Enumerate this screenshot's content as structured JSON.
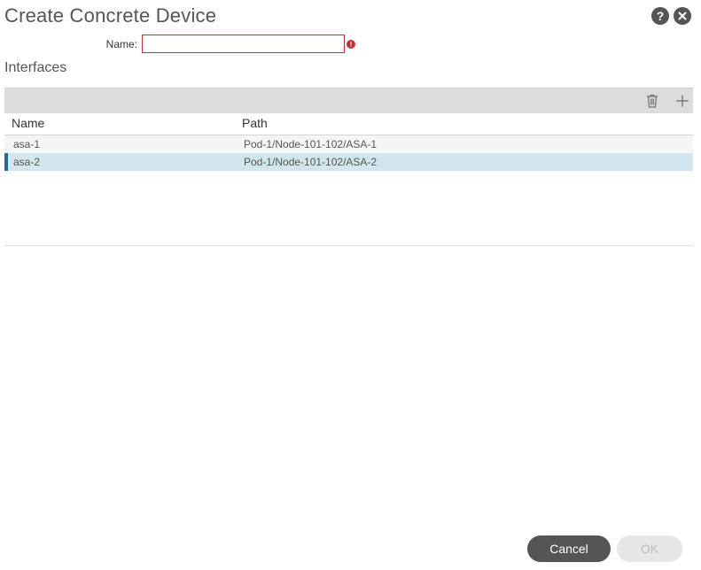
{
  "dialog": {
    "title": "Create Concrete Device",
    "help_icon": "question-icon",
    "close_icon": "close-icon"
  },
  "form": {
    "name_label": "Name:",
    "name_value": "",
    "name_placeholder": "",
    "error_icon": "error-icon"
  },
  "interfaces": {
    "section_label": "Interfaces",
    "toolbar": {
      "delete_icon": "trash-icon",
      "add_icon": "plus-icon"
    },
    "columns": [
      "Name",
      "Path"
    ],
    "rows": [
      {
        "name": "asa-1",
        "path": "Pod-1/Node-101-102/ASA-1",
        "selected": false
      },
      {
        "name": "asa-2",
        "path": "Pod-1/Node-101-102/ASA-2",
        "selected": true
      }
    ]
  },
  "footer": {
    "cancel_label": "Cancel",
    "ok_label": "OK"
  },
  "colors": {
    "error": "#c0303c",
    "selected_row": "#d2e6ef",
    "selected_accent": "#1d6f8e",
    "primary_button": "#555555"
  }
}
